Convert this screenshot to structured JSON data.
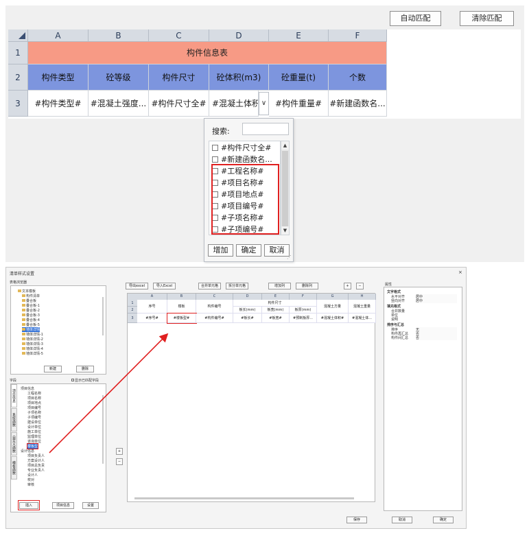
{
  "top": {
    "buttons": {
      "auto_match": "自动匹配",
      "clear_match": "清除匹配"
    },
    "col_headers": [
      "A",
      "B",
      "C",
      "D",
      "E",
      "F"
    ],
    "row_headers": [
      "1",
      "2",
      "3"
    ],
    "title_row": "构件信息表",
    "header_row": [
      "构件类型",
      "砼等级",
      "构件尺寸",
      "砼体积(m3)",
      "砼重量(t)",
      "个数"
    ],
    "data_row": [
      "#构件类型#",
      "#混凝土强度...",
      "#构件尺寸全#",
      "#混凝土体积",
      "#构件重量#",
      "#新建函数名..."
    ],
    "colors": {
      "title_bg": "#f79a85",
      "header_bg": "#7d95de",
      "highlight": "#e02020"
    },
    "popup": {
      "search_label": "搜索:",
      "search_value": "",
      "items": [
        "#构件尺寸全#",
        "#新建函数名...",
        "#工程名称#",
        "#项目名称#",
        "#项目地点#",
        "#项目编号#",
        "#子项名称#",
        "#子项编号#"
      ],
      "btn_add": "增加",
      "btn_ok": "确定",
      "btn_cancel": "取消"
    }
  },
  "dialog": {
    "title": "清单样式设置",
    "close": "×",
    "tree_panel_label": "表格浏览器",
    "tree_items": [
      "文本模板",
      "构件清单",
      "叠合板",
      "叠合板-1",
      "叠合板-2",
      "叠合板-3",
      "叠合板-4",
      "叠合板-5",
      "墙体详情",
      "墙体详情-1",
      "墙体详情-2",
      "墙体详情-3",
      "墙体详情-4",
      "墙体详情-5"
    ],
    "tree_btn_new": "新建",
    "tree_btn_delete": "删除",
    "fields_label": "字段",
    "show_fields_check": "显示已匹配字段",
    "side_tabs": [
      "项目信息",
      "系统函数",
      "自定义函数",
      "模板函数"
    ],
    "field_groups": [
      {
        "name": "项目信息",
        "items": [
          "工程名称",
          "项目名称",
          "项目地点",
          "项目编号",
          "子项名称",
          "子项编号",
          "建设单位",
          "设计单位",
          "施工单位",
          "监理单位",
          "咨询单位",
          "楼板型"
        ]
      },
      {
        "name": "设计信息",
        "items": [
          "项目负责人",
          "方案设计人",
          "项目总负责",
          "专业负责人",
          "设计人",
          "校对",
          "审核"
        ]
      }
    ],
    "field_btn_insert": "插入",
    "field_btn_project": "项目信息",
    "field_btn_settings": "设置",
    "toolbar": [
      "导出excel",
      "导入Excel",
      "合并单元格",
      "拆分单元格",
      "增加列",
      "删除列",
      "+",
      "−"
    ],
    "mini_col_headers": [
      "A",
      "B",
      "C",
      "D",
      "E",
      "F",
      "G",
      "H"
    ],
    "mini_row_headers": [
      "1",
      "2",
      "3"
    ],
    "mini_header_top": [
      "序号",
      "楼板",
      "构件编号",
      "构件尺寸",
      "",
      "",
      "混凝土方量",
      "混凝土重量"
    ],
    "mini_subheaders": [
      "板长(mm)",
      "板宽(mm)",
      "板厚(mm)"
    ],
    "mini_data_row": [
      "#序号#",
      "#楼板型#",
      "#构件编号#",
      "#板长#",
      "#板宽#",
      "#预制板厚...",
      "#混凝土体积#",
      "#混凝土体..."
    ],
    "props_title": "属性",
    "props": [
      {
        "group": "文字格式",
        "rows": [
          [
            "水平对齐",
            "居中"
          ],
          [
            "竖向对齐",
            "居中"
          ]
        ]
      },
      {
        "group": "填充格式",
        "rows": [
          [
            "合并数量",
            ""
          ],
          [
            "单位",
            ""
          ],
          [
            "说明",
            ""
          ]
        ]
      },
      {
        "group": "排序与汇总",
        "rows": [
          [
            "排序",
            "无"
          ],
          [
            "构件再汇总",
            "否"
          ],
          [
            "构件间汇总",
            "否"
          ]
        ]
      }
    ],
    "btn_save": "保存",
    "btn_cancel": "取消",
    "btn_ok": "确定",
    "mid_plus": "+",
    "mid_minus": "−"
  }
}
